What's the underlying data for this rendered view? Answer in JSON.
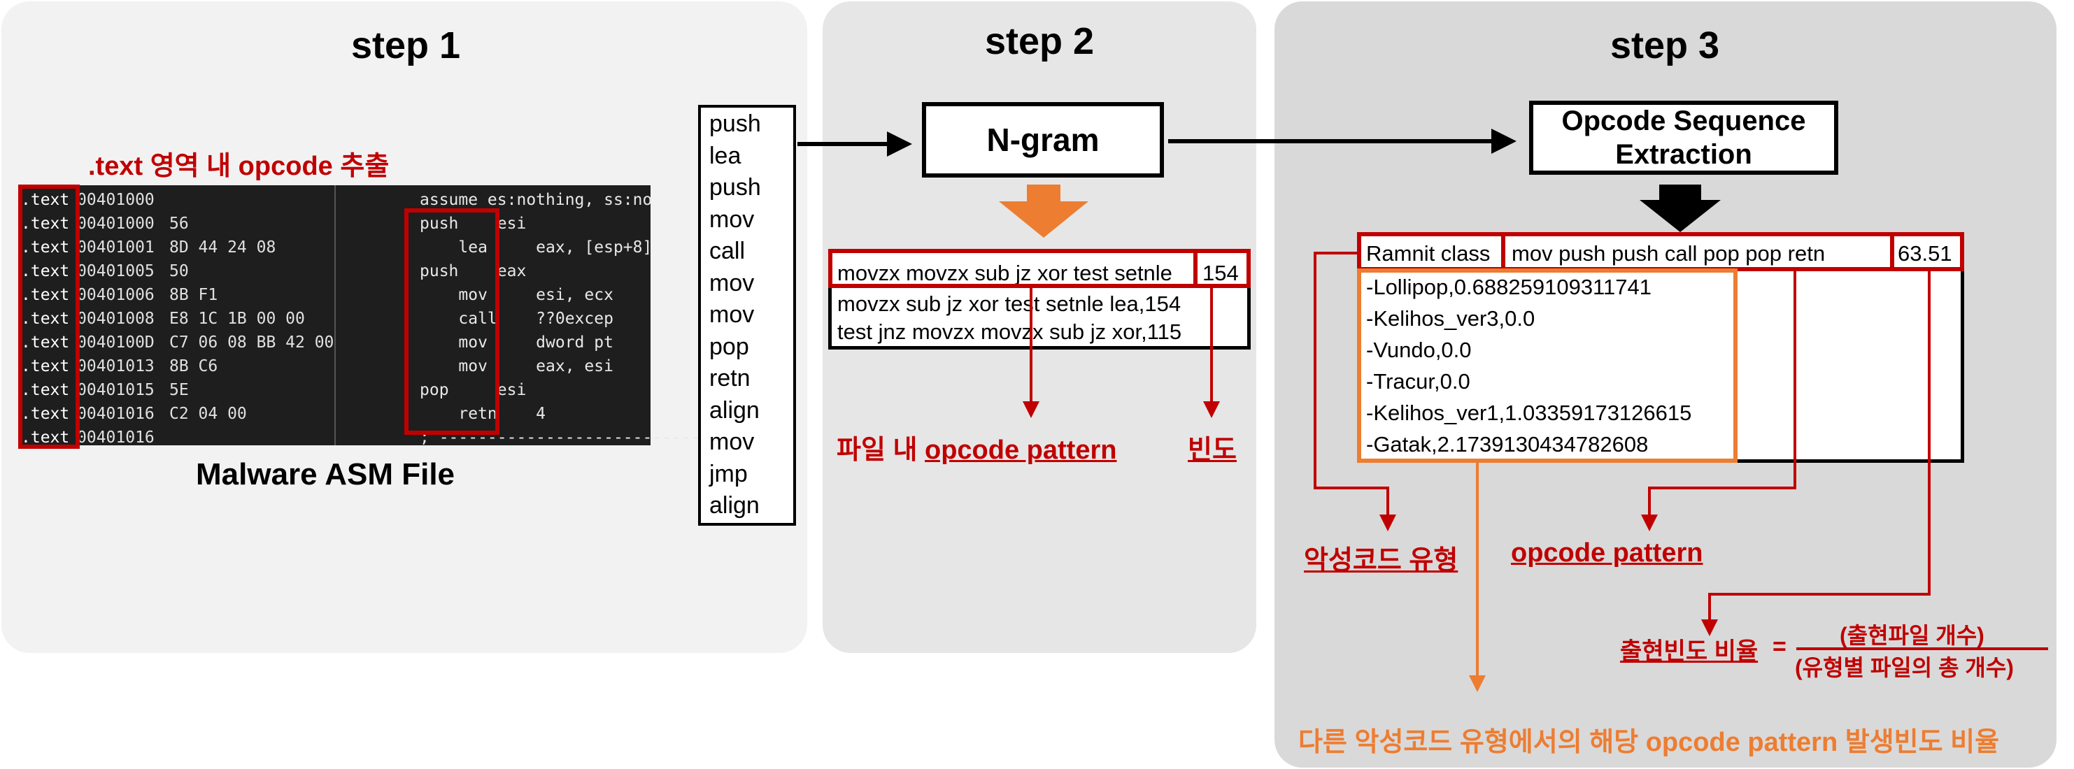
{
  "step1": {
    "title": "step 1",
    "caption": ".text 영역 내 opcode 추출",
    "file_label": "Malware ASM File",
    "asm_lines": [
      {
        "seg": ".text",
        "addr": "00401000",
        "bytes": "",
        "asm": "assume es:nothing, ss:no"
      },
      {
        "seg": ".text",
        "addr": "00401000",
        "bytes": "56",
        "asm": "push    esi"
      },
      {
        "seg": ".text",
        "addr": "00401001",
        "bytes": "8D 44 24 08",
        "asm": "    lea     eax, [esp+8]"
      },
      {
        "seg": ".text",
        "addr": "00401005",
        "bytes": "50",
        "asm": "push    eax"
      },
      {
        "seg": ".text",
        "addr": "00401006",
        "bytes": "8B F1",
        "asm": "    mov     esi, ecx"
      },
      {
        "seg": ".text",
        "addr": "00401008",
        "bytes": "E8 1C 1B 00 00",
        "asm": "    call    ??0excep"
      },
      {
        "seg": ".text",
        "addr": "0040100D",
        "bytes": "C7 06 08 BB 42 00",
        "asm": "    mov     dword pt"
      },
      {
        "seg": ".text",
        "addr": "00401013",
        "bytes": "8B C6",
        "asm": "    mov     eax, esi"
      },
      {
        "seg": ".text",
        "addr": "00401015",
        "bytes": "5E",
        "asm": "pop     esi"
      },
      {
        "seg": ".text",
        "addr": "00401016",
        "bytes": "C2 04 00",
        "asm": "    retn    4"
      },
      {
        "seg": ".text",
        "addr": "00401016",
        "bytes": "",
        "asm": "; ----------------------------"
      }
    ]
  },
  "opcodes": [
    "push",
    "lea",
    "push",
    "mov",
    "call",
    "mov",
    "mov",
    "pop",
    "retn",
    "align",
    "mov",
    "jmp",
    "align"
  ],
  "step2": {
    "title": "step 2",
    "box_label": "N-gram",
    "rows": [
      "movzx movzx sub jz xor test setnle,154",
      "movzx sub jz xor test setnle lea,154",
      "test jnz movzx movzx sub jz xor,115"
    ],
    "first_row_pattern": "movzx movzx sub jz xor test setnle",
    "first_row_count": "154",
    "label_pattern_prefix": "파일 내 ",
    "label_pattern": "opcode pattern",
    "label_freq": "빈도"
  },
  "step3": {
    "title": "step 3",
    "box_label_line1": "Opcode Sequence",
    "box_label_line2": "Extraction",
    "header_class": "Ramnit class",
    "header_pattern": "mov push push call pop pop retn",
    "header_value": "63.51",
    "others": [
      "-Lollipop,0.688259109311741",
      "-Kelihos_ver3,0.0",
      "-Vundo,0.0",
      "-Tracur,0.0",
      "-Kelihos_ver1,1.03359173126615",
      "-Gatak,2.1739130434782608"
    ],
    "label_malware_type": "악성코드 유형",
    "label_opcode_pattern": "opcode pattern",
    "formula_label": "출현빈도 비율",
    "formula_eq": "=",
    "formula_numerator": "(출현파일 개수)",
    "formula_denominator": "(유형별 파일의 총 개수)",
    "bottom_note": "다른 악성코드 유형에서의 해당 opcode pattern 발생빈도 비율"
  },
  "colors": {
    "red": "#c00000",
    "orange": "#ed7d31",
    "black": "#000000"
  }
}
